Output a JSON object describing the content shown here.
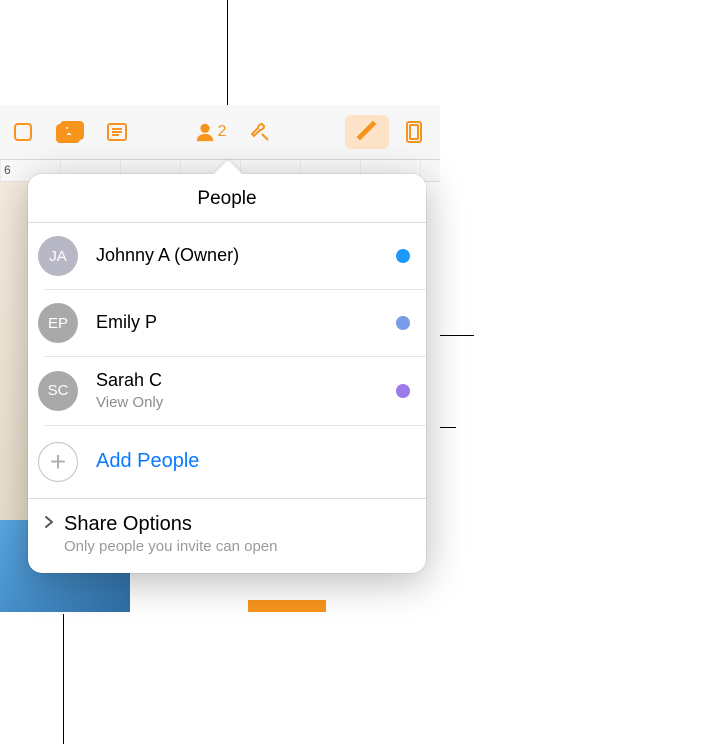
{
  "toolbar": {
    "collab_count": "2"
  },
  "ruler_label": "6",
  "popover": {
    "title": "People",
    "participants": [
      {
        "initials": "JA",
        "name": "Johnny A (Owner)",
        "subtitle": "",
        "avatarBg": "#b7b7c5",
        "dot": "#1a99ff"
      },
      {
        "initials": "EP",
        "name": "Emily P",
        "subtitle": "",
        "avatarBg": "#a9a9a9",
        "dot": "#7a9be8"
      },
      {
        "initials": "SC",
        "name": "Sarah C",
        "subtitle": "View Only",
        "avatarBg": "#a9a9a9",
        "dot": "#9c7be8"
      }
    ],
    "add_label": "Add People",
    "share_title": "Share Options",
    "share_subtitle": "Only people you invite can open"
  }
}
